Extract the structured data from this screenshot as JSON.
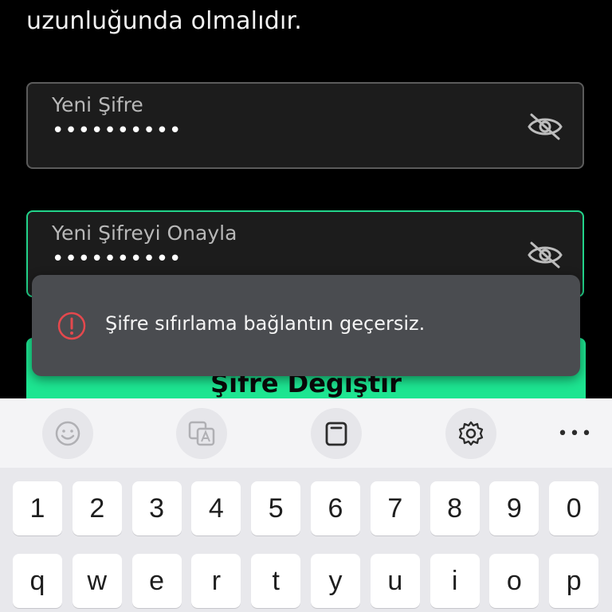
{
  "instruction_text": "uzunluğunda olmalıdır.",
  "new_password": {
    "label": "Yeni Şifre",
    "value": "••••••••••"
  },
  "confirm_password": {
    "label": "Yeni Şifreyi Onayla",
    "value": "••••••••••"
  },
  "submit_button": {
    "label": "Şifre Değiştir"
  },
  "toast": {
    "message": "Şifre sıfırlama bağlantın geçersiz."
  },
  "keyboard": {
    "toolbar": [
      "emoji-icon",
      "translate-icon",
      "clipboard-icon",
      "settings-icon",
      "more-icon"
    ],
    "more_label": "•••",
    "number_row": [
      "1",
      "2",
      "3",
      "4",
      "5",
      "6",
      "7",
      "8",
      "9",
      "0"
    ],
    "letter_row": [
      "q",
      "w",
      "e",
      "r",
      "t",
      "y",
      "u",
      "i",
      "o",
      "p"
    ]
  },
  "colors": {
    "accent": "#1de591",
    "focus_border": "#22d38a",
    "error": "#e5484d",
    "toast_bg": "#4a4c50"
  }
}
